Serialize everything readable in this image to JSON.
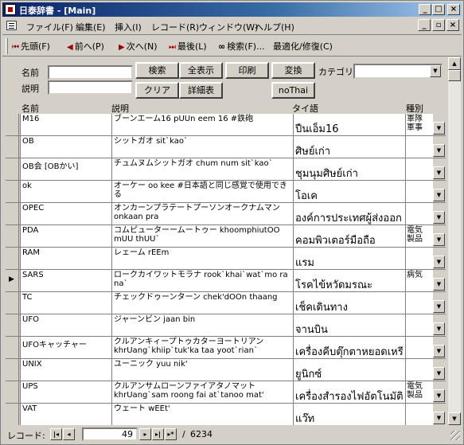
{
  "window": {
    "title": "日泰辞書 - [Main]"
  },
  "menu": [
    "ファイル(F)",
    "編集(E)",
    "挿入(I)",
    "レコード(R)",
    "ウィンドウ(W)",
    "ヘルプ(H)"
  ],
  "nav": {
    "first": "先頭(F)",
    "prev": "前へ(P)",
    "next": "次へ(N)",
    "last": "最後(L)",
    "search": "検索(F)...",
    "optimize": "最適化/修復(C)"
  },
  "form": {
    "name_label": "名前",
    "desc_label": "説明",
    "category_label": "カテゴリ",
    "buttons": {
      "search": "検索",
      "show_all": "全表示",
      "print": "印刷",
      "convert": "変換",
      "clear": "クリア",
      "detail": "詳細表",
      "nothai": "noThai"
    }
  },
  "columns": [
    "名前",
    "説明",
    "タイ語",
    "種別"
  ],
  "rows": [
    {
      "name": "M16",
      "desc": "ブーンエーム16 pUUn eem 16 #鉄砲",
      "thai": "ปืนเอ็ม16",
      "type": "軍隊\n軍事",
      "current": false
    },
    {
      "name": "OB",
      "desc": "シットガオ sit`kao`",
      "thai": "ศิษย์เก่า",
      "type": "",
      "current": false
    },
    {
      "name": "OB会 [OBかい]",
      "desc": "チュムヌムシットガオ chum num sit`kao`",
      "thai": "ชุมนุมศิษย์เก่า",
      "type": "",
      "current": false
    },
    {
      "name": "ok",
      "desc": "オーケー oo kee #日本語と同じ感覚で使用できる",
      "thai": "โอเค",
      "type": "",
      "current": false
    },
    {
      "name": "OPEC",
      "desc": "オンカーンプラテートプーソンオークナムマン onkaan pra",
      "thai": "องค์การประเทศผู้ส่งออก",
      "type": "",
      "current": false
    },
    {
      "name": "PDA",
      "desc": "コムピューターームートゥー khoomphiutOO mUU thUU`",
      "thai": "คอมพิวเตอร์มือถือ",
      "type": "電気\n製品",
      "current": false
    },
    {
      "name": "RAM",
      "desc": "レェーム rEEm",
      "thai": "แรม",
      "type": "",
      "current": false
    },
    {
      "name": "SARS",
      "desc": "ロークカイワットモラナ rook`khai`wat`mo ra na`",
      "thai": "โรคไข้หวัดมรณะ",
      "type": "病気",
      "current": true
    },
    {
      "name": "TC",
      "desc": "チェックドゥーンターン chek'dOOn thaang",
      "thai": "เช็คเดินทาง",
      "type": "",
      "current": false
    },
    {
      "name": "UFO",
      "desc": "ジャーンビン jaan bin",
      "thai": "จานบิน",
      "type": "",
      "current": false
    },
    {
      "name": "UFOキャッチャー",
      "desc": "クルアンキィープトゥカターヨートリアン khrUang`khiip`tuk'ka taa yoot`rian`",
      "thai": "เครื่องคีบตุ๊กตาหยอดเหรี",
      "type": "",
      "current": false
    },
    {
      "name": "UNIX",
      "desc": "ユーニック yuu nik'",
      "thai": "ยูนิกซ์",
      "type": "",
      "current": false
    },
    {
      "name": "UPS",
      "desc": "クルアンサムローンファイアタノマット khrUang`sam roong fai at`tanoo mat'",
      "thai": "เครื่องสำรองไฟอัตโนมัติ",
      "type": "電気\n製品",
      "current": false
    },
    {
      "name": "VAT",
      "desc": "ウェート wEEt'",
      "thai": "แว๊ท",
      "type": "",
      "current": false
    }
  ],
  "status": {
    "label": "レコード:",
    "current": "49",
    "sep": "/",
    "total": "6234"
  }
}
